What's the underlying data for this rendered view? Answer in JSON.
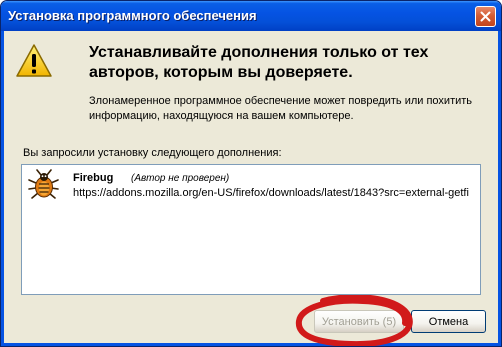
{
  "window": {
    "title": "Установка программного обеспечения"
  },
  "heading": "Устанавливайте дополнения только от тех авторов, которым вы доверяете.",
  "description": "Злонамеренное программное обеспечение может повредить или похитить информацию, находящуюся на вашем компьютере.",
  "request_label": "Вы запросили установку следующего дополнения:",
  "addon": {
    "name": "Firebug",
    "note": "(Автор не проверен)",
    "url": "https://addons.mozilla.org/en-US/firefox/downloads/latest/1843?src=external-getfi"
  },
  "buttons": {
    "install_label": "Установить (5)",
    "cancel_label": "Отмена"
  },
  "icons": {
    "warning": "warning-icon",
    "addon": "firebug-icon",
    "close": "close-icon"
  },
  "annotation_color": "#d11a1a"
}
